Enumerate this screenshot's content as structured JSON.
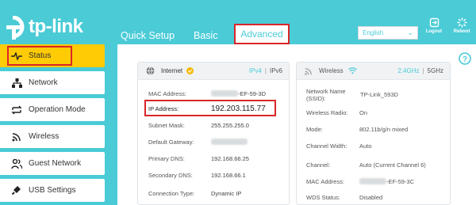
{
  "brand": {
    "logo_text": "tp-link"
  },
  "nav": {
    "quick_setup": "Quick Setup",
    "basic": "Basic",
    "advanced": "Advanced"
  },
  "header": {
    "language": "English",
    "logout": "Logout",
    "reboot": "Reboot"
  },
  "sidebar": {
    "items": [
      {
        "label": "Status",
        "icon": "pulse-icon",
        "active": true
      },
      {
        "label": "Network",
        "icon": "network-icon"
      },
      {
        "label": "Operation Mode",
        "icon": "swap-icon"
      },
      {
        "label": "Wireless",
        "icon": "wifi-icon"
      },
      {
        "label": "Guest Network",
        "icon": "users-icon"
      },
      {
        "label": "USB Settings",
        "icon": "usb-icon"
      }
    ]
  },
  "internet": {
    "title": "Internet",
    "ipv4": "IPv4",
    "ipv6": "IPv6",
    "rows": {
      "mac_label": "MAC Address:",
      "mac_value": "-EF-59-3D",
      "ip_label": "IP Address:",
      "ip_value": "192.203.115.77",
      "subnet_label": "Subnet Mask:",
      "subnet_value": "255.255.255.0",
      "gateway_label": "Default Gateway:",
      "pdns_label": "Primary DNS:",
      "pdns_value": "192.168.66.25",
      "sdns_label": "Secondary DNS:",
      "sdns_value": "192.168.66.1",
      "conn_label": "Connection Type:",
      "conn_value": "Dynamic IP"
    }
  },
  "wireless": {
    "title": "Wireless",
    "band_24": "2.4GHz",
    "band_5": "5GHz",
    "rows": {
      "ssid_label": "Network Name (SSID):",
      "ssid_value": "TP-Link_593D",
      "radio_label": "Wireless Radio:",
      "radio_value": "On",
      "mode_label": "Mode:",
      "mode_value": "802.11b/g/n mixed",
      "width_label": "Channel Width:",
      "width_value": "Auto",
      "channel_label": "Channel:",
      "channel_value": "Auto (Current Channel 6)",
      "mac_label": "MAC Address:",
      "mac_value": "-EF-59-3C",
      "wds_label": "WDS Status:",
      "wds_value": "Disabled"
    }
  },
  "colors": {
    "accent": "#4acbd6",
    "active": "#ffcb05",
    "highlight": "#d9262a"
  }
}
